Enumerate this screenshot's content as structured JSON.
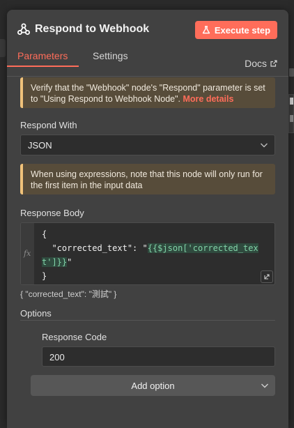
{
  "header": {
    "title": "Respond to Webhook",
    "execute_label": "Execute step"
  },
  "tabs": {
    "parameters": "Parameters",
    "settings": "Settings",
    "docs": "Docs"
  },
  "notice1": {
    "text": "Verify that the \"Webhook\" node's \"Respond\" parameter is set to \"Using Respond to Webhook Node\". ",
    "link": "More details"
  },
  "respond_with": {
    "label": "Respond With",
    "value": "JSON"
  },
  "notice2": {
    "text": "When using expressions, note that this node will only run for the first item in the input data"
  },
  "response_body": {
    "label": "Response Body",
    "gutter": "fx",
    "line1": "{",
    "line2_key": "  \"corrected_text\": \"",
    "line2_expr": "{{$json['corrected_tex",
    "line3_expr": "t']}}",
    "line3_tail": "\"",
    "line4": "}",
    "preview": "{   \"corrected_text\": \"測試\" }"
  },
  "options": {
    "header": "Options",
    "response_code_label": "Response Code",
    "response_code_value": "200",
    "add_option_label": "Add option"
  },
  "colors": {
    "accent": "#ff6d5a",
    "panel_bg": "#414141",
    "notice_border": "#f0c27a",
    "expression_text": "#82d3a8"
  }
}
